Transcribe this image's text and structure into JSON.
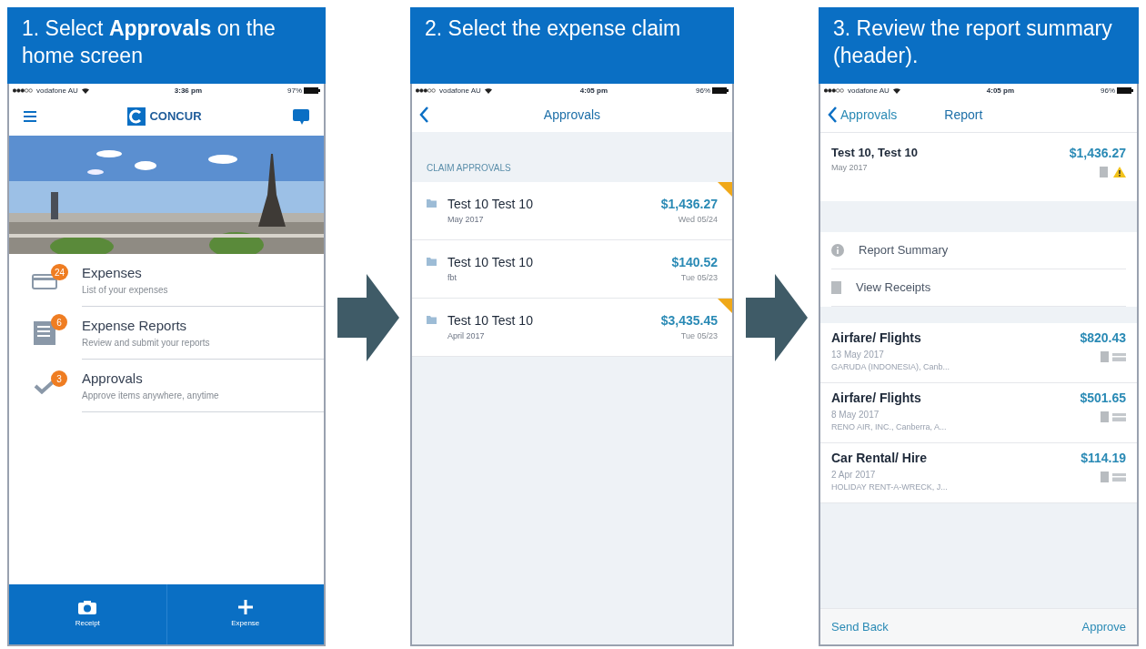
{
  "panels": [
    {
      "kind": "home",
      "caption": "1. Select **Approvals** on the home screen",
      "status": {
        "carrier": "vodafone AU",
        "time": "3:36 pm",
        "battery": "97%"
      },
      "logo": "CONCUR",
      "menu": [
        {
          "kind": "expenses",
          "title": "Expenses",
          "subtitle": "List of your expenses",
          "badge": "24"
        },
        {
          "kind": "reports",
          "title": "Expense Reports",
          "subtitle": "Review and submit your reports",
          "badge": "6"
        },
        {
          "kind": "approvals",
          "title": "Approvals",
          "subtitle": "Approve items anywhere, anytime",
          "badge": "3"
        }
      ],
      "bottom_buttons": [
        {
          "kind": "camera",
          "label": "Receipt"
        },
        {
          "kind": "plus",
          "label": "Expense"
        }
      ]
    },
    {
      "kind": "list",
      "caption": "2. Select the expense claim",
      "status": {
        "carrier": "vodafone AU",
        "time": "4:05 pm",
        "battery": "96%"
      },
      "nav_title": "Approvals",
      "section": "CLAIM APPROVALS",
      "claims": [
        {
          "title": "Test 10 Test 10",
          "subtitle": "May 2017",
          "amount": "$1,436.27",
          "date": "Wed 05/24",
          "flagged": true
        },
        {
          "title": "Test 10 Test 10",
          "subtitle": "fbt",
          "amount": "$140.52",
          "date": "Tue 05/23",
          "flagged": false
        },
        {
          "title": "Test 10 Test 10",
          "subtitle": "April 2017",
          "amount": "$3,435.45",
          "date": "Tue 05/23",
          "flagged": true
        }
      ]
    },
    {
      "kind": "report",
      "caption": "3. Review the report summary (header).",
      "status": {
        "carrier": "vodafone AU",
        "time": "4:05 pm",
        "battery": "96%"
      },
      "back": "Approvals",
      "nav_title": "Report",
      "header": {
        "title": "Test 10, Test 10",
        "subtitle": "May 2017",
        "amount": "$1,436.27",
        "warning": true
      },
      "actions": [
        {
          "kind": "info",
          "label": "Report Summary"
        },
        {
          "kind": "receipt",
          "label": "View Receipts"
        }
      ],
      "expenses": [
        {
          "title": "Airfare/ Flights",
          "date": "13 May 2017",
          "vendor": "GARUDA (INDONESIA), Canb...",
          "amount": "$820.43"
        },
        {
          "title": "Airfare/ Flights",
          "date": "8 May 2017",
          "vendor": "RENO AIR, INC., Canberra, A...",
          "amount": "$501.65"
        },
        {
          "title": "Car Rental/ Hire",
          "date": "2 Apr 2017",
          "vendor": "HOLIDAY RENT-A-WRECK, J...",
          "amount": "$114.19"
        }
      ],
      "footer": {
        "left": "Send Back",
        "right": "Approve"
      }
    }
  ]
}
